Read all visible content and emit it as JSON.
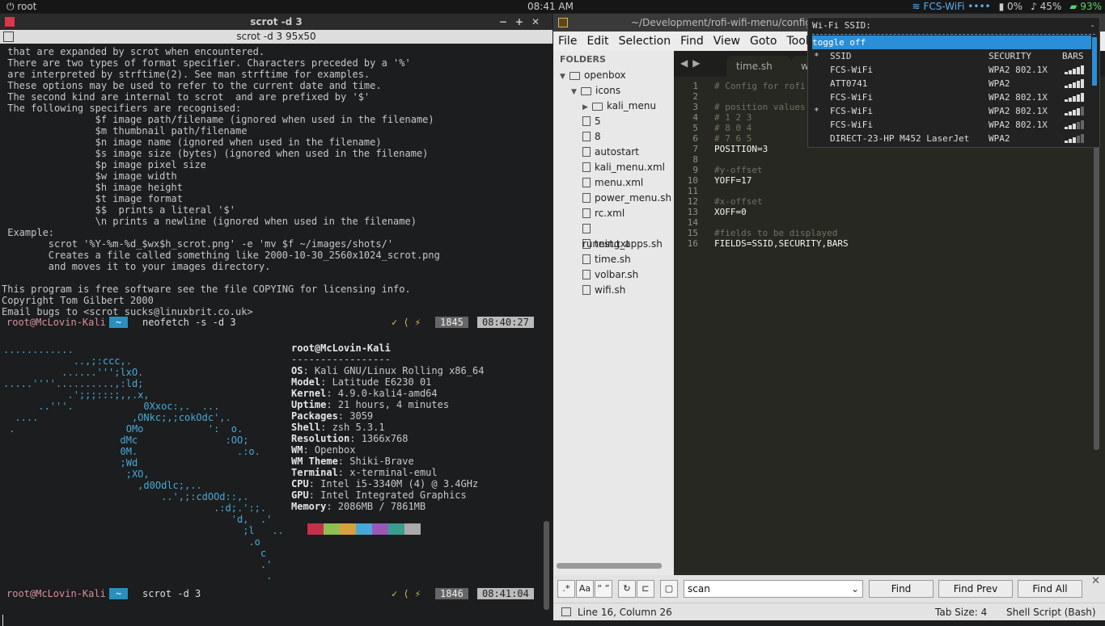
{
  "topbar": {
    "user": "root",
    "clock": "08:41 AM",
    "wifi": "FCS-WiFi ••••",
    "cpu": "0%",
    "volume": "45%",
    "battery": "93%"
  },
  "terminal": {
    "title": "scrot -d 3",
    "tab_title": "scrot -d 3 95x50",
    "man_text": " that are expanded by scrot when encountered.\n There are two types of format specifier. Characters preceded by a '%'\n are interpreted by strftime(2). See man strftime for examples.\n These options may be used to refer to the current date and time.\n The second kind are internal to scrot  and are prefixed by '$'\n The following specifiers are recognised:\n                $f image path/filename (ignored when used in the filename)\n                $m thumbnail path/filename\n                $n image name (ignored when used in the filename)\n                $s image size (bytes) (ignored when used in the filename)\n                $p image pixel size\n                $w image width\n                $h image height\n                $t image format\n                $$  prints a literal '$'\n                \\n prints a newline (ignored when used in the filename)\n Example:\n        scrot '%Y-%m-%d_$wx$h_scrot.png' -e 'mv $f ~/images/shots/'\n        Creates a file called something like 2000-10-30_2560x1024_scrot.png\n        and moves it to your images directory.\n\nThis program is free software see the file COPYING for licensing info.\nCopyright Tom Gilbert 2000\nEmail bugs to <scrot_sucks@linuxbrit.co.uk>",
    "prompt1": {
      "user": "root@McLovin-Kali",
      "dir": "~",
      "cmd": "neofetch -s -d 3",
      "symbols": "✓ ⟨ ⚡",
      "hist": "1845",
      "time": "08:40:27"
    },
    "prompt2": {
      "user": "root@McLovin-Kali",
      "dir": "~",
      "cmd": "scrot -d 3",
      "symbols": "✓ ⟨ ⚡",
      "hist": "1846",
      "time": "08:41:04"
    },
    "logo": "............\n            ..,;:ccc,.\n          ......''';lxO.\n.....''''..........,:ld;\n           .';;;:::;,,.x,\n      ..'''.            0Xxoc:,.  ...\n  ....                ,ONkc;,;cokOdc',.\n .                   OMo           ':  o.\n                    dMc               :OO;\n                    0M.                 .:o.\n                    ;Wd\n                     ;XO,\n                       ,d0Odlc;,..\n                           ..',;:cdOOd::,.\n                                    .:d;.':;.\n                                       'd,  .'\n                                         ;l   ..\n                                          .o\n                                            c\n                                            .'\n                                             .",
    "neofetch": {
      "header": "root@McLovin-Kali",
      "sep": "-----------------",
      "rows": [
        {
          "k": "OS",
          "v": ": Kali GNU/Linux Rolling x86_64"
        },
        {
          "k": "Model",
          "v": ": Latitude E6230 01"
        },
        {
          "k": "Kernel",
          "v": ": 4.9.0-kali4-amd64"
        },
        {
          "k": "Uptime",
          "v": ": 21 hours, 4 minutes"
        },
        {
          "k": "Packages",
          "v": ": 3059"
        },
        {
          "k": "Shell",
          "v": ": zsh 5.3.1"
        },
        {
          "k": "Resolution",
          "v": ": 1366x768"
        },
        {
          "k": "WM",
          "v": ": Openbox"
        },
        {
          "k": "WM Theme",
          "v": ": Shiki-Brave"
        },
        {
          "k": "Terminal",
          "v": ": x-terminal-emul"
        },
        {
          "k": "CPU",
          "v": ": Intel i5-3340M (4) @ 3.4GHz"
        },
        {
          "k": "GPU",
          "v": ": Intel Integrated Graphics"
        },
        {
          "k": "Memory",
          "v": ": 2086MB / 7861MB"
        }
      ],
      "colors": [
        "#1b1d1e",
        "#c4314b",
        "#8fbf54",
        "#d8a03c",
        "#4aa8d8",
        "#9b59b6",
        "#3a9d8f",
        "#aaaaaa"
      ]
    }
  },
  "editor": {
    "title": "~/Development/rofi-wifi-menu/config",
    "menu": [
      "File",
      "Edit",
      "Selection",
      "Find",
      "View",
      "Goto",
      "Tools"
    ],
    "folders_header": "FOLDERS",
    "tree": [
      {
        "label": "openbox",
        "type": "folder-open",
        "depth": 0
      },
      {
        "label": "icons",
        "type": "folder-open",
        "depth": 1
      },
      {
        "label": "kali_menu",
        "type": "folder",
        "depth": 2
      },
      {
        "label": "5",
        "type": "file",
        "depth": 2
      },
      {
        "label": "8",
        "type": "file",
        "depth": 2
      },
      {
        "label": "autostart",
        "type": "file",
        "depth": 2
      },
      {
        "label": "kali_menu.xml",
        "type": "file",
        "depth": 2
      },
      {
        "label": "menu.xml",
        "type": "file",
        "depth": 2
      },
      {
        "label": "power_menu.sh",
        "type": "file",
        "depth": 2
      },
      {
        "label": "rc.xml",
        "type": "file",
        "depth": 2
      },
      {
        "label": "running_apps.sh",
        "type": "file",
        "depth": 2
      },
      {
        "label": "test.txt",
        "type": "file",
        "depth": 2
      },
      {
        "label": "time.sh",
        "type": "file",
        "depth": 2
      },
      {
        "label": "volbar.sh",
        "type": "file",
        "depth": 2
      },
      {
        "label": "wifi.sh",
        "type": "file",
        "depth": 2
      }
    ],
    "tabs": [
      "time.sh",
      "w"
    ],
    "gutter": "1\n2\n3\n4\n5\n6\n7\n8\n9\n10\n11\n12\n13\n14\n15\n16",
    "code_lines": [
      "# Config for rofi",
      "",
      "# position values:",
      "# 1 2 3",
      "# 8 0 4",
      "# 7 6 5",
      "POSITION=3",
      "",
      "#y-offset",
      "YOFF=17",
      "",
      "#x-offset",
      "XOFF=0",
      "",
      "#fields to be displayed",
      "FIELDS=SSID,SECURITY,BARS"
    ],
    "find": {
      "options": [
        ".*",
        "Aa",
        "“ ”",
        "↻",
        "⊏",
        "▢"
      ],
      "value": "scan",
      "find": "Find",
      "find_prev": "Find Prev",
      "find_all": "Find All"
    },
    "status": {
      "position": "Line 16, Column 26",
      "tab_size": "Tab Size: 4",
      "syntax": "Shell Script (Bash)"
    }
  },
  "rofi": {
    "prompt": "Wi-Fi SSID:",
    "trail": "-",
    "toggle": "toggle off",
    "header": {
      "mark": "*",
      "ssid": "SSID",
      "security": "SECURITY",
      "bars": "BARS"
    },
    "networks": [
      {
        "mark": "",
        "ssid": "FCS-WiFi",
        "security": "WPA2 802.1X",
        "bars": 4
      },
      {
        "mark": "",
        "ssid": "ATT0741",
        "security": "WPA2",
        "bars": 4
      },
      {
        "mark": "",
        "ssid": "FCS-WiFi",
        "security": "WPA2 802.1X",
        "bars": 4
      },
      {
        "mark": "*",
        "ssid": "FCS-WiFi",
        "security": "WPA2 802.1X",
        "bars": 3
      },
      {
        "mark": "",
        "ssid": "FCS-WiFi",
        "security": "WPA2 802.1X",
        "bars": 2
      },
      {
        "mark": "",
        "ssid": "DIRECT-23-HP M452 LaserJet",
        "security": "WPA2",
        "bars": 2
      }
    ]
  }
}
